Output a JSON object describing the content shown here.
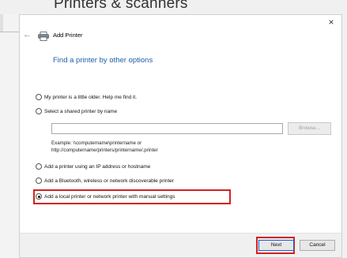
{
  "background": {
    "title": "Printers & scanners"
  },
  "dialog": {
    "title": "Add Printer",
    "heading": "Find a printer by other options",
    "options": [
      {
        "label": "My printer is a little older. Help me find it.",
        "checked": false
      },
      {
        "label": "Select a shared printer by name",
        "checked": false
      },
      {
        "label": "Add a printer using an IP address or hostname",
        "checked": false
      },
      {
        "label": "Add a Bluetooth, wireless or network discoverable printer",
        "checked": false
      },
      {
        "label": "Add a local printer or network printer with manual settings",
        "checked": true
      }
    ],
    "shared_path": {
      "value": "",
      "placeholder": ""
    },
    "browse_label": "Browse...",
    "example_line1": "Example: \\\\computername\\printername or",
    "example_line2": "http://computername/printers/printername/.printer",
    "next_label": "Next",
    "cancel_label": "Cancel",
    "close_glyph": "×",
    "back_glyph": "←"
  },
  "colors": {
    "heading": "#1a5fa8",
    "highlight": "#d0231f"
  },
  "icons": [
    "close-icon",
    "back-arrow-icon",
    "printer-icon"
  ]
}
